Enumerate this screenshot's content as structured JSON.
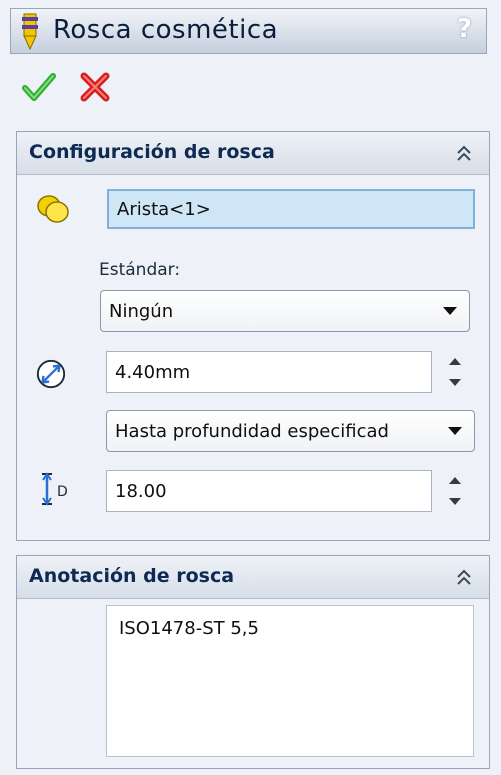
{
  "titlebar": {
    "title": "Rosca cosmética",
    "help_label": "?"
  },
  "actions": {
    "ok_icon": "green-check-icon",
    "cancel_icon": "red-x-icon",
    "ok_color": "#2fae2f",
    "cancel_color": "#d42020"
  },
  "thread_settings": {
    "title": "Configuración de rosca",
    "edge_value": "Arista<1>",
    "standard_label": "Estándar:",
    "standard_value": "Ningún",
    "diameter_value": "4.40mm",
    "end_condition_value": "Hasta profundidad especificad",
    "depth_value": "18.00",
    "depth_icon_letter": "D"
  },
  "thread_callout": {
    "title": "Anotación de rosca",
    "text": "ISO1478-ST 5,5"
  }
}
